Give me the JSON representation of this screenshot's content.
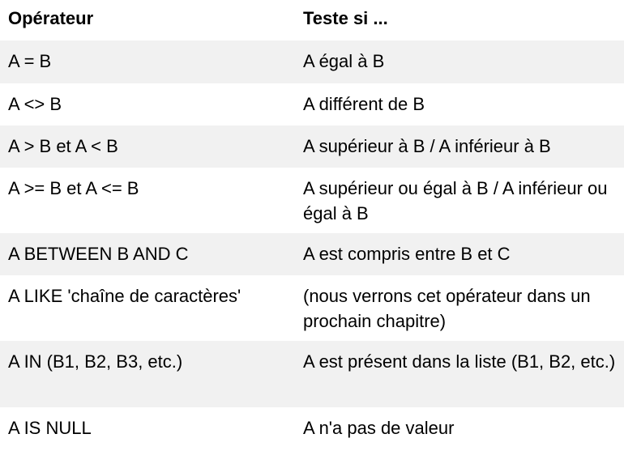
{
  "table": {
    "headers": [
      "Opérateur",
      "Teste si ..."
    ],
    "rows": [
      {
        "operator": "A = B",
        "test": "A égal à B"
      },
      {
        "operator": "A <> B",
        "test": "A différent de B"
      },
      {
        "operator": "A > B et A < B",
        "test": "A supérieur à B / A inférieur à B"
      },
      {
        "operator": "A >= B et A <= B",
        "test": "A supérieur ou égal à B / A inférieur ou égal à B"
      },
      {
        "operator": "A BETWEEN B AND C",
        "test": "A est compris entre B et C"
      },
      {
        "operator": "A LIKE 'chaîne de caractères'",
        "test": "(nous verrons cet opérateur dans un prochain chapitre)"
      },
      {
        "operator": "A IN (B1, B2, B3, etc.)",
        "test": "A est présent dans la liste (B1, B2, etc.)"
      },
      {
        "operator": "A IS NULL",
        "test": "A n'a pas de valeur"
      }
    ]
  },
  "colors": {
    "row_shade": "#f1f1f1",
    "background": "#ffffff",
    "text": "#000000"
  }
}
